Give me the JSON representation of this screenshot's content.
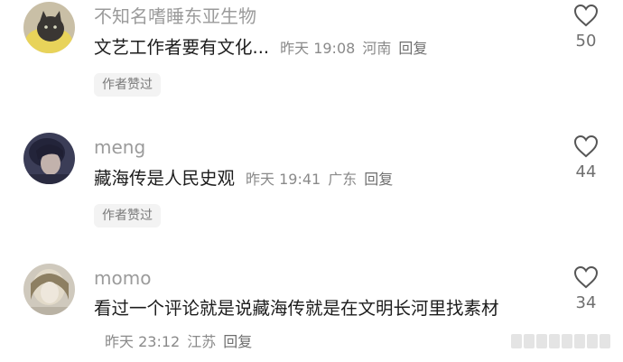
{
  "comments": [
    {
      "username": "不知名嗜睡东亚生物",
      "text": "文艺工作者要有文化...",
      "time": "昨天 19:08",
      "location": "河南",
      "reply_label": "回复",
      "badge": "作者赞过",
      "likes": "50",
      "avatar_icon": "avatar-cat-photo-icon"
    },
    {
      "username": "meng",
      "text": "藏海传是人民史观",
      "time": "昨天 19:41",
      "location": "广东",
      "reply_label": "回复",
      "badge": "作者赞过",
      "likes": "44",
      "avatar_icon": "avatar-person-dark-photo-icon"
    },
    {
      "username": "momo",
      "text": "看过一个评论就是说藏海传就是在文明长河里找素材",
      "time": "昨天 23:12",
      "location": "江苏",
      "reply_label": "回复",
      "likes": "34",
      "avatar_icon": "avatar-person-light-photo-icon"
    }
  ],
  "icons": {
    "like": "heart-outline-icon"
  },
  "colors": {
    "text": "#1c1c1c",
    "username": "#9b9b9b",
    "meta": "#8a8a8a",
    "badge_bg": "#f3f3f3"
  }
}
